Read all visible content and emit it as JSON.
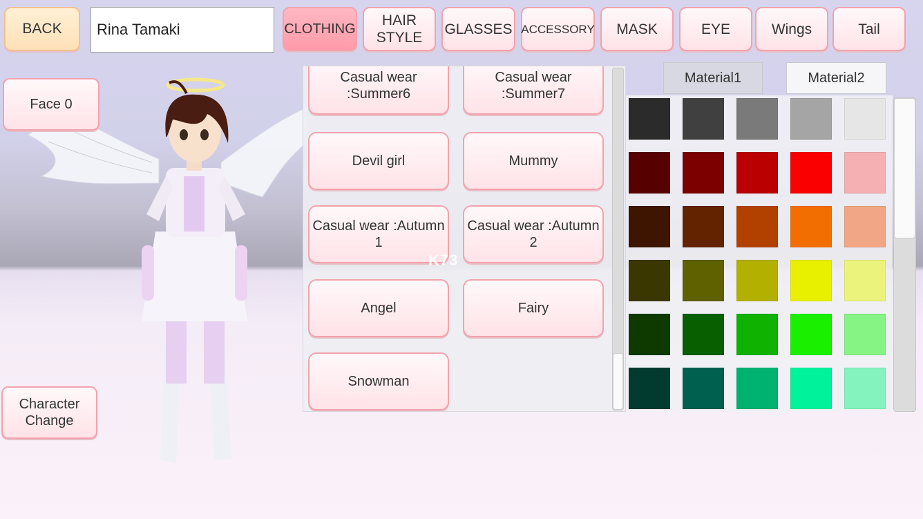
{
  "header": {
    "back_label": "BACK",
    "character_name": "Rina Tamaki",
    "tabs": [
      {
        "label": "CLOTHING",
        "active": true
      },
      {
        "label": "HAIR STYLE",
        "active": false
      },
      {
        "label": "GLASSES",
        "active": false
      },
      {
        "label": "ACCESSORY",
        "active": false
      },
      {
        "label": "MASK",
        "active": false
      },
      {
        "label": "EYE",
        "active": false
      },
      {
        "label": "Wings",
        "active": false
      },
      {
        "label": "Tail",
        "active": false
      }
    ]
  },
  "side": {
    "face_label": "Face",
    "face_value": "0",
    "character_change_label": "Character Change"
  },
  "outfits": [
    "Casual wear :Summer6",
    "Casual wear :Summer7",
    "Devil girl",
    "Mummy",
    "Casual wear :Autumn 1",
    "Casual wear :Autumn 2",
    "Angel",
    "Fairy",
    "Snowman"
  ],
  "materials": {
    "material1": "Material1",
    "material2": "Material2",
    "selected": "Material1"
  },
  "colors": [
    [
      "#2b2b2b",
      "#404040",
      "#7a7a7a",
      "#a5a5a5",
      "#e6e6e6"
    ],
    [
      "#560000",
      "#7c0000",
      "#ba0000",
      "#fb0000",
      "#f4b0b3"
    ],
    [
      "#3d1500",
      "#642300",
      "#b24100",
      "#f36e00",
      "#f1a785"
    ],
    [
      "#3b3700",
      "#5f6000",
      "#b3b000",
      "#e8f000",
      "#ecf37c"
    ],
    [
      "#0e3a00",
      "#075f00",
      "#0fb200",
      "#18f000",
      "#86f385"
    ],
    [
      "#013b2f",
      "#006050",
      "#00b270",
      "#00f39b",
      "#85f3be"
    ]
  ],
  "watermark": "K73"
}
